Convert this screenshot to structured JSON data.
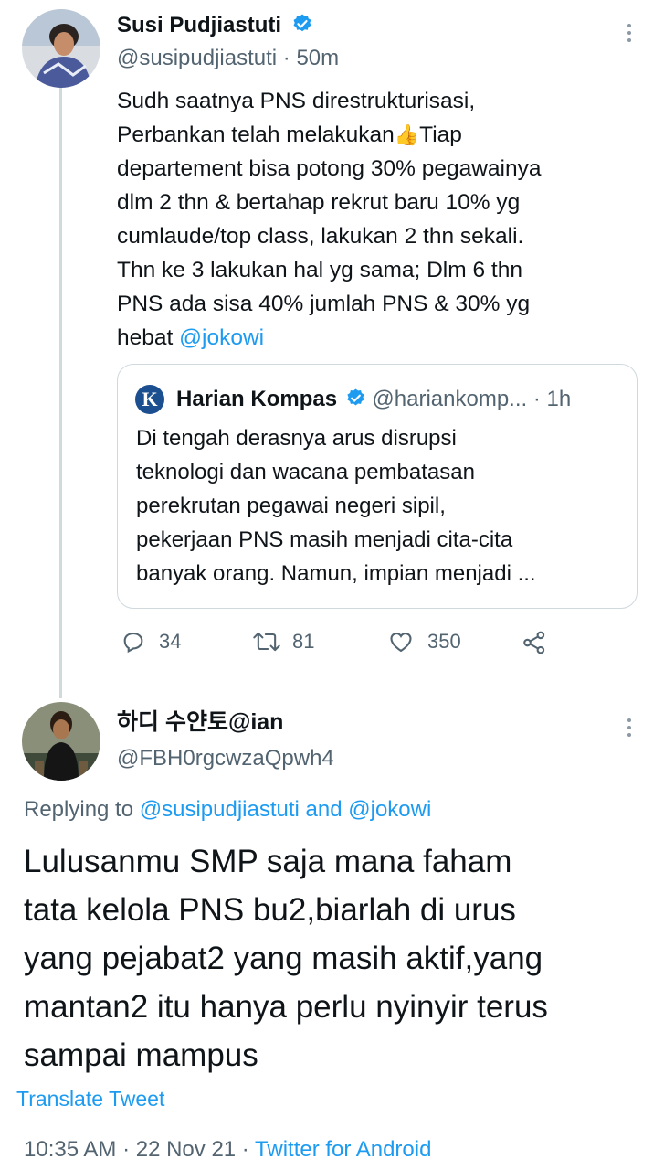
{
  "tweet": {
    "author_name": "Susi Pudjiastuti",
    "handle_time": "@susipudjiastuti · 50m",
    "text_before_emoji": "Sudh saatnya PNS direstrukturisasi,\nPerbankan telah melakukan",
    "emoji": "👍",
    "text_after_emoji": "Tiap\ndepartement bisa potong 30% pegawainya\ndlm 2 thn & bertahap rekrut baru 10% yg\ncumlaude/top class, lakukan 2 thn sekali.\nThn ke 3 lakukan hal yg sama; Dlm 6 thn\nPNS ada sisa 40% jumlah PNS & 30% yg\nhebat ",
    "mention": "@jokowi",
    "replies": "34",
    "retweets": "81",
    "likes": "350"
  },
  "quoted": {
    "logo_letter": "K",
    "name": "Harian Kompas",
    "handle": "@hariankomp...",
    "time": "· 1h",
    "text": "Di tengah derasnya arus disrupsi\nteknologi dan wacana pembatasan\nperekrutan pegawai negeri sipil,\npekerjaan PNS masih menjadi cita-cita\nbanyak orang. Namun, impian menjadi ..."
  },
  "reply": {
    "author_name": "하디 수얀토@ian",
    "handle": "@FBH0rgcwzaQpwh4",
    "replying_prefix": "Replying to ",
    "replying_to": "@susipudjiastuti and @jokowi",
    "text": "Lulusanmu SMP saja mana faham\ntata kelola PNS bu2,biarlah di urus\nyang pejabat2 yang masih aktif,yang\nmantan2 itu hanya perlu nyinyir terus\nsampai mampus",
    "translate": "Translate Tweet",
    "time_date": "10:35 AM · 22 Nov 21 · ",
    "source": "Twitter for Android"
  },
  "colors": {
    "accent": "#1d9bf0",
    "secondary_text": "#536471",
    "border": "#cfd9de"
  }
}
